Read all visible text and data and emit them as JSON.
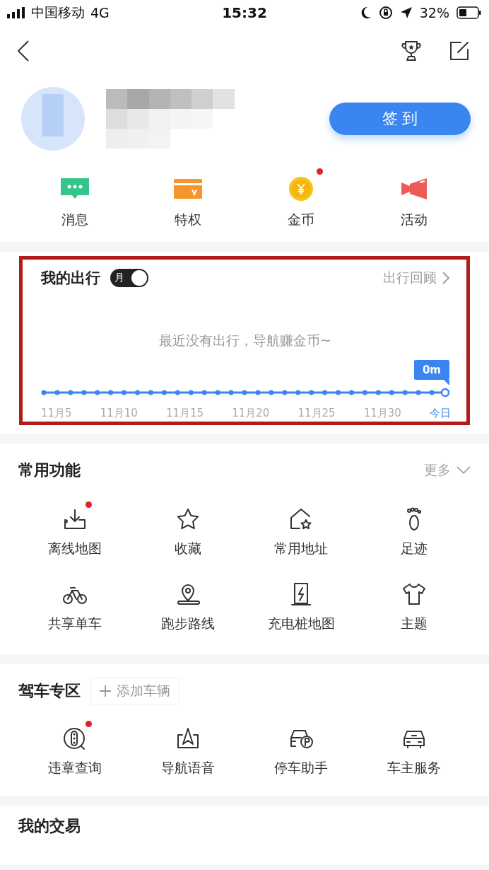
{
  "status_bar": {
    "carrier": "中国移动",
    "network": "4G",
    "time": "15:32",
    "battery": "32%"
  },
  "profile": {
    "sign_in_button": "签 到"
  },
  "quick_links": [
    {
      "label": "消息",
      "badge": false
    },
    {
      "label": "特权",
      "badge": false
    },
    {
      "label": "金币",
      "badge": true
    },
    {
      "label": "活动",
      "badge": false
    }
  ],
  "trip": {
    "title": "我的出行",
    "toggle": {
      "label": "月",
      "on": true
    },
    "link": "出行回顾",
    "empty_message": "最近没有出行，导航赚金币~",
    "bubble": "0m",
    "dates": [
      "11月5",
      "11月10",
      "11月15",
      "11月20",
      "11月25",
      "11月30"
    ],
    "today": "今日"
  },
  "features": {
    "title": "常用功能",
    "more": "更多",
    "items": [
      {
        "label": "离线地图",
        "badge": true
      },
      {
        "label": "收藏",
        "badge": false
      },
      {
        "label": "常用地址",
        "badge": false
      },
      {
        "label": "足迹",
        "badge": false
      },
      {
        "label": "共享单车",
        "badge": false
      },
      {
        "label": "跑步路线",
        "badge": false
      },
      {
        "label": "充电桩地图",
        "badge": false
      },
      {
        "label": "主题",
        "badge": false
      }
    ]
  },
  "driving": {
    "title": "驾车专区",
    "add_vehicle": "添加车辆",
    "items": [
      {
        "label": "违章查询",
        "badge": true
      },
      {
        "label": "导航语音",
        "badge": false
      },
      {
        "label": "停车助手",
        "badge": false
      },
      {
        "label": "车主服务",
        "badge": false
      }
    ]
  },
  "transactions": {
    "title": "我的交易"
  }
}
